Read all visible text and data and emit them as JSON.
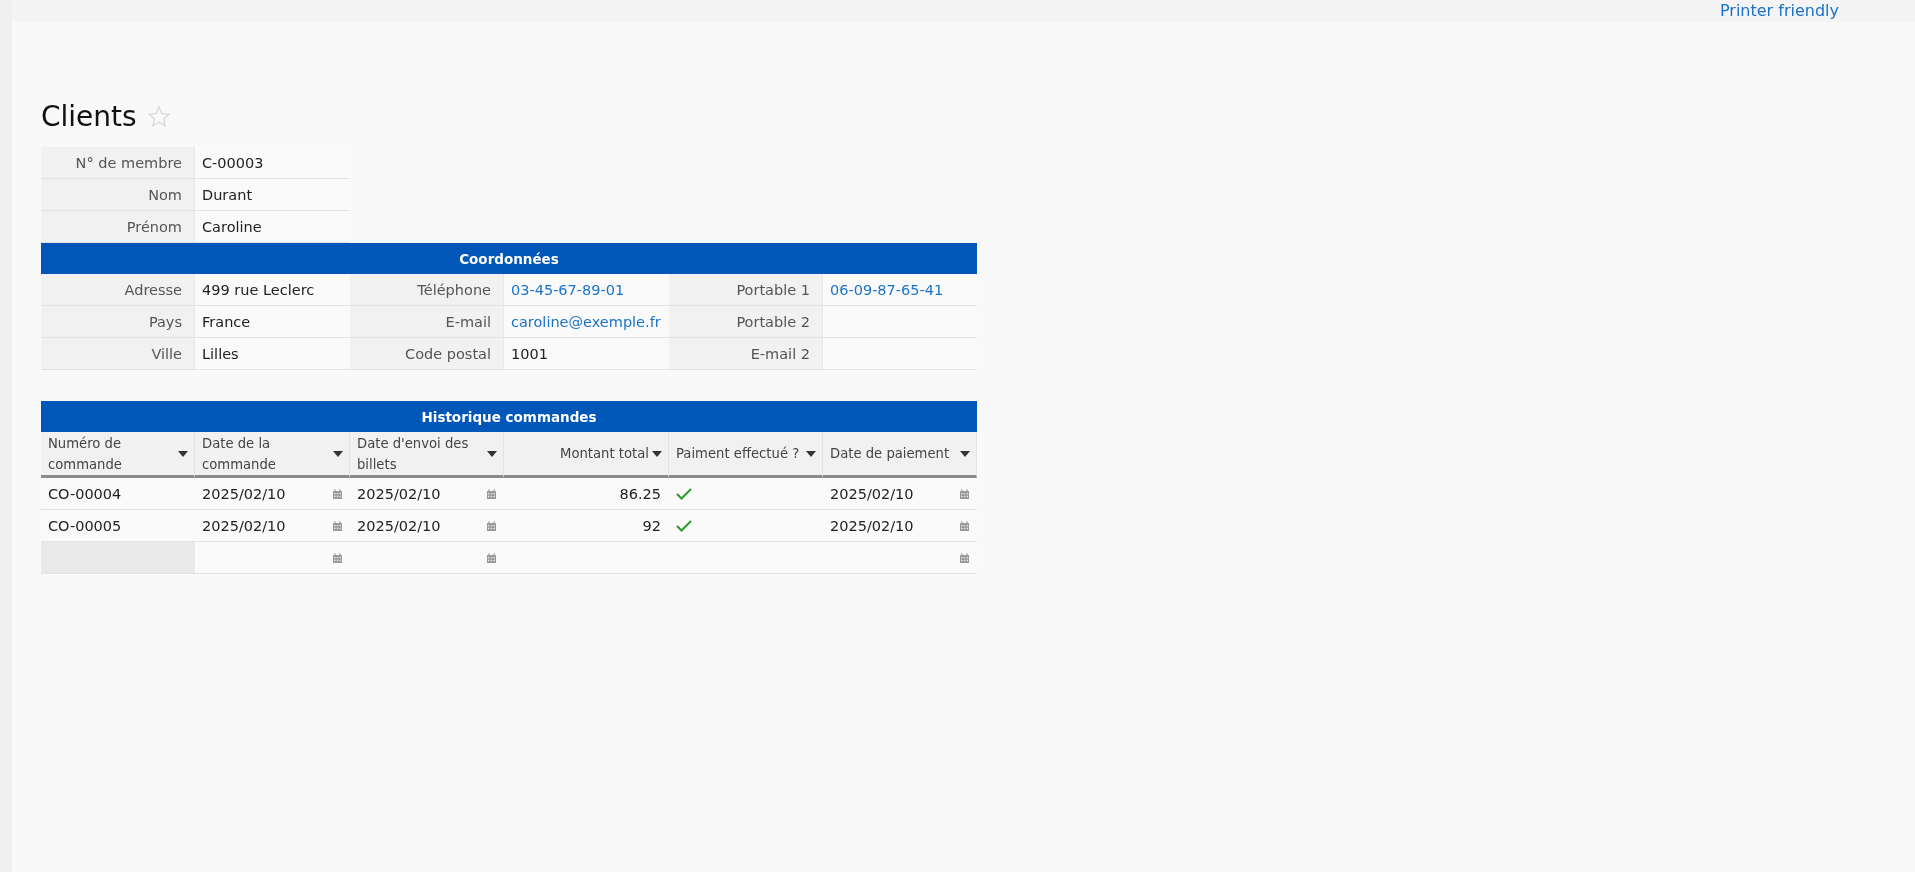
{
  "top_bar": {
    "link": "Printer friendly"
  },
  "title": "Clients",
  "favorite": false,
  "member_fields": [
    {
      "label": "N° de membre",
      "value": "C-00003"
    },
    {
      "label": "Nom",
      "value": "Durant"
    },
    {
      "label": "Prénom",
      "value": "Caroline"
    }
  ],
  "contact": {
    "title": "Coordonnées",
    "rows": [
      [
        {
          "label": "Adresse",
          "value": "499 rue Leclerc",
          "kind": "text"
        },
        {
          "label": "Téléphone",
          "value": "03-45-67-89-01",
          "kind": "link"
        },
        {
          "label": "Portable 1",
          "value": "06-09-87-65-41",
          "kind": "link"
        }
      ],
      [
        {
          "label": "Pays",
          "value": "France",
          "kind": "text"
        },
        {
          "label": "E-mail",
          "value": "caroline@exemple.fr",
          "kind": "link"
        },
        {
          "label": "Portable 2",
          "kind": "text"
        }
      ],
      [
        {
          "label": "Ville",
          "value": "Lilles",
          "kind": "text"
        },
        {
          "label": "Code postal",
          "value": "1001",
          "kind": "text"
        },
        {
          "label": "E-mail 2",
          "kind": "text"
        }
      ]
    ]
  },
  "orders": {
    "title": "Historique commandes",
    "columns": [
      {
        "label": "Numéro de commande",
        "kind": "text"
      },
      {
        "label": "Date de la commande",
        "kind": "date"
      },
      {
        "label": "Date d'envoi des billets",
        "kind": "date"
      },
      {
        "label": "Montant total",
        "kind": "number"
      },
      {
        "label": "Paiment effectué ?",
        "kind": "check"
      },
      {
        "label": "Date de paiement",
        "kind": "date"
      }
    ],
    "rows": [
      {
        "new": false,
        "cells": [
          "CO-00004",
          "2025/02/10",
          "2025/02/10",
          "86.25",
          true,
          "2025/02/10"
        ]
      },
      {
        "new": false,
        "cells": [
          "CO-00005",
          "2025/02/10",
          "2025/02/10",
          "92",
          true,
          "2025/02/10"
        ]
      },
      {
        "new": true,
        "cells": [
          null,
          null,
          null,
          null,
          false,
          null
        ]
      }
    ]
  }
}
